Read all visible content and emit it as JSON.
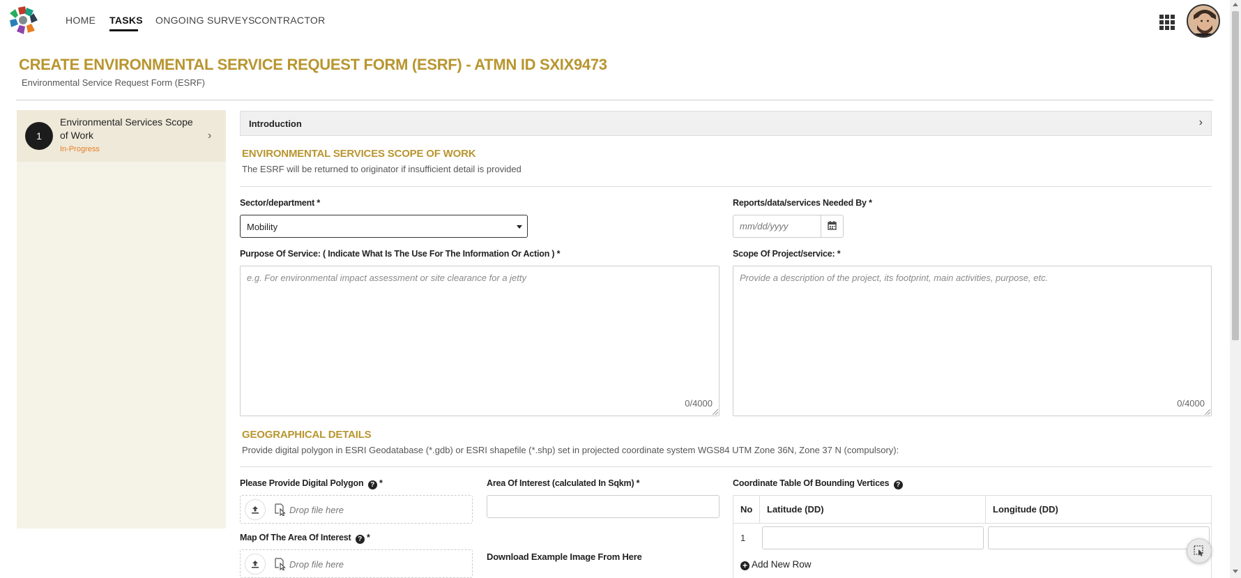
{
  "nav": {
    "items": [
      "HOME",
      "TASKS",
      "ONGOING SURVEYS",
      "CONTRACTOR"
    ],
    "active": "TASKS"
  },
  "page": {
    "title": "CREATE ENVIRONMENTAL SERVICE REQUEST FORM (ESRF) - ATMN ID SXIX9473",
    "subtitle": "Environmental Service Request Form (ESRF)"
  },
  "sidebar": {
    "steps": [
      {
        "number": "1",
        "title": "Environmental Services Scope of Work",
        "status": "In-Progress"
      }
    ]
  },
  "intro": {
    "label": "Introduction"
  },
  "scope_section": {
    "title": "ENVIRONMENTAL SERVICES SCOPE OF WORK",
    "description": "The ESRF will be returned to originator if insufficient detail is provided"
  },
  "fields": {
    "sector_label": "Sector/department *",
    "sector_value": "Mobility",
    "needed_by_label": "Reports/data/services Needed By *",
    "needed_by_placeholder": "mm/dd/yyyy",
    "purpose_label": "Purpose Of Service: ( Indicate What Is The Use For The Information Or Action ) *",
    "purpose_placeholder": "e.g. For environmental impact assessment or site clearance for a jetty",
    "purpose_counter": "0/4000",
    "scope_label": "Scope Of Project/service: *",
    "scope_placeholder": "Provide a description of the project, its footprint, main activities, purpose, etc.",
    "scope_counter": "0/4000"
  },
  "geo_section": {
    "title": "GEOGRAPHICAL DETAILS",
    "description": "Provide digital polygon in ESRI Geodatabase (*.gdb) or ESRI shapefile (*.shp)  set in projected coordinate system WGS84 UTM Zone 36N, Zone 37 N (compulsory):",
    "polygon_label": "Please Provide Digital Polygon",
    "area_label": "Area Of Interest (calculated In Sqkm) *",
    "map_label": "Map Of The Area Of Interest",
    "drop_text": "Drop file here",
    "download_text": "Download Example Image From Here",
    "coord_label": "Coordinate Table Of Bounding Vertices",
    "required_mark": "*",
    "help_glyph": "?",
    "table": {
      "headers": [
        "No",
        "Latitude (DD)",
        "Longitude (DD)"
      ],
      "rows": [
        {
          "no": "1",
          "lat": "",
          "lon": ""
        }
      ]
    },
    "add_row": "Add New Row"
  },
  "colors": {
    "accent": "#b8952f",
    "status": "#e67e22",
    "sidebar_bg": "#f5f2e8"
  },
  "icons": {
    "apps": "grid-apps-icon",
    "calendar": "calendar-icon",
    "upload": "upload-icon",
    "drop": "file-drop-icon",
    "help": "question-circle-icon",
    "add": "plus-circle-icon",
    "chevron": "chevron-right-icon",
    "fab": "cursor-select-icon"
  }
}
